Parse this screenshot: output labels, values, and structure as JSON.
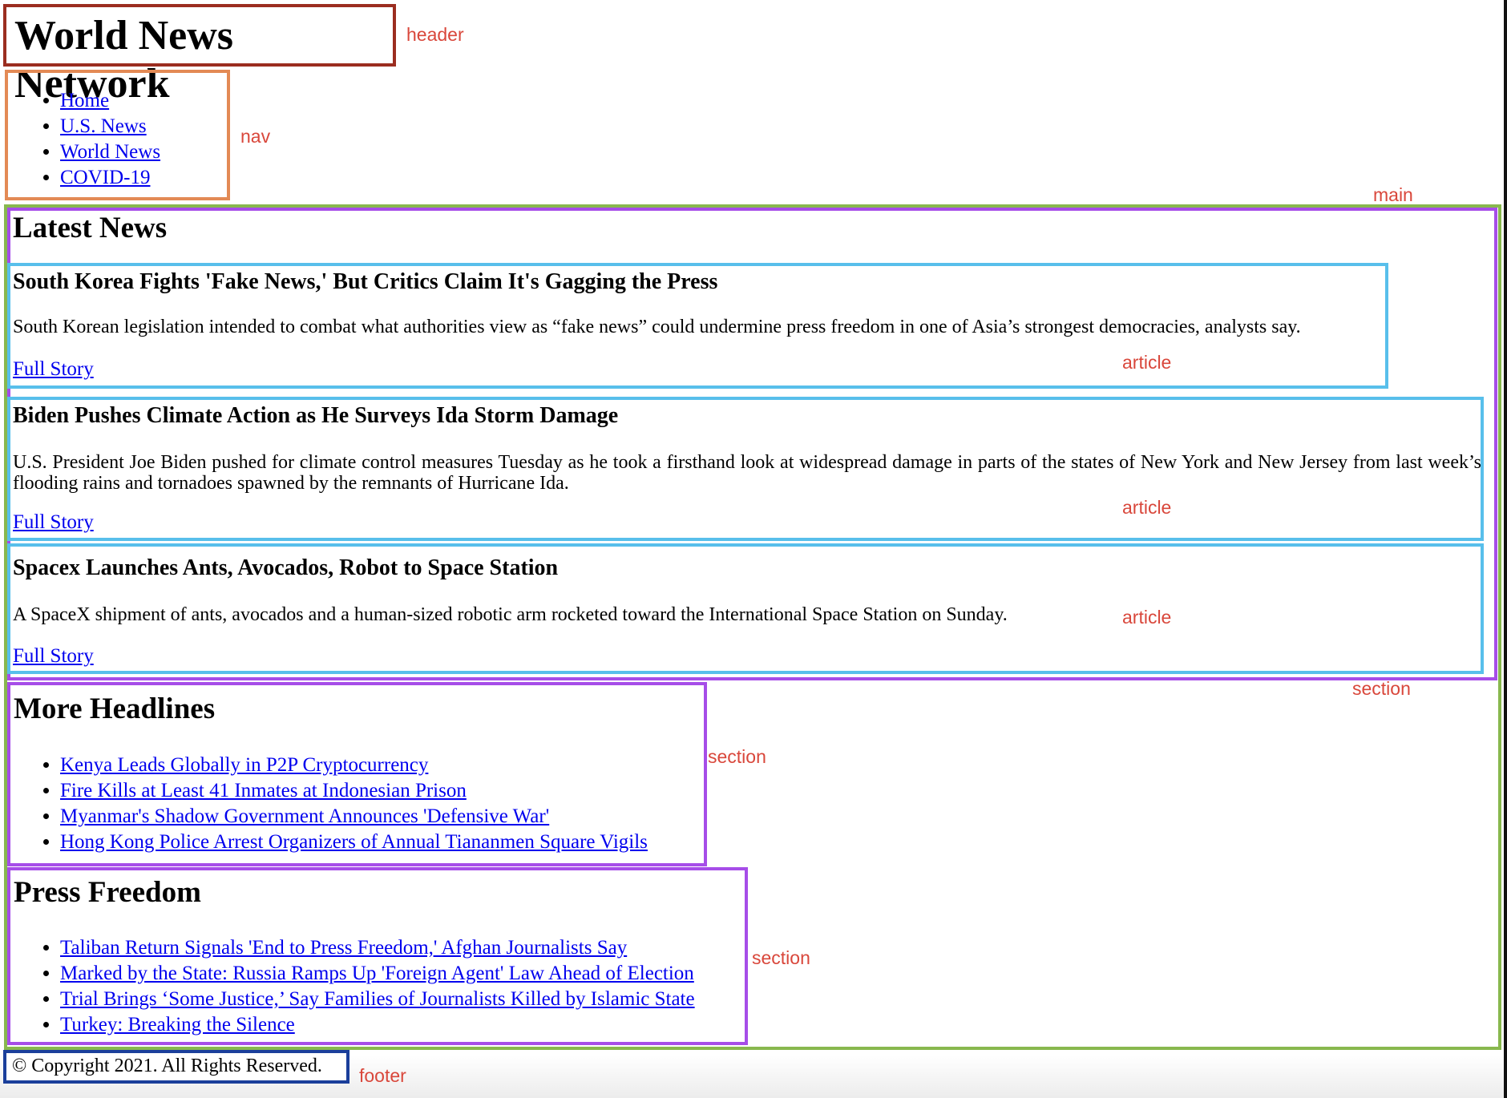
{
  "colors": {
    "header_border": "#9b2d20",
    "nav_border": "#e38a55",
    "main_border": "#88b84e",
    "section_border": "#a64de8",
    "article_border": "#58bfeb",
    "footer_border": "#1b3f9b",
    "label_text": "#d9473b",
    "link": "#0000ee"
  },
  "labels": {
    "header": "header",
    "nav": "nav",
    "main": "main",
    "section": "section",
    "article": "article",
    "footer": "footer"
  },
  "header": {
    "title": "World News Network"
  },
  "nav": {
    "items": [
      "Home",
      "U.S. News",
      "World News",
      "COVID-19"
    ]
  },
  "latest": {
    "heading": "Latest News",
    "articles": [
      {
        "title": "South Korea Fights 'Fake News,' But Critics Claim It's Gagging the Press",
        "summary": "South Korean legislation intended to combat what authorities view as “fake news” could undermine press freedom in one of Asia’s strongest democracies, analysts say.",
        "link": "Full Story"
      },
      {
        "title": "Biden Pushes Climate Action as He Surveys Ida Storm Damage",
        "summary": "U.S. President Joe Biden pushed for climate control measures Tuesday as he took a firsthand look at widespread damage in parts of the states of New York and New Jersey from last week’s flooding rains and tornadoes spawned by the remnants of Hurricane Ida.",
        "link": "Full Story"
      },
      {
        "title": "Spacex Launches Ants, Avocados, Robot to Space Station",
        "summary": "A SpaceX shipment of ants, avocados and a human-sized robotic arm rocketed toward the International Space Station on Sunday.",
        "link": "Full Story"
      }
    ]
  },
  "more": {
    "heading": "More Headlines",
    "items": [
      "Kenya Leads Globally in P2P Cryptocurrency",
      "Fire Kills at Least 41 Inmates at Indonesian Prison",
      "Myanmar's Shadow Government Announces 'Defensive War'",
      "Hong Kong Police Arrest Organizers of Annual Tiananmen Square Vigils"
    ]
  },
  "press": {
    "heading": "Press Freedom",
    "items": [
      "Taliban Return Signals 'End to Press Freedom,' Afghan Journalists Say",
      "Marked by the State: Russia Ramps Up 'Foreign Agent' Law Ahead of Election",
      "Trial Brings ‘Some Justice,’ Say Families of Journalists Killed by Islamic State",
      "Turkey: Breaking the Silence"
    ]
  },
  "footer": {
    "text": "© Copyright 2021. All Rights Reserved."
  }
}
